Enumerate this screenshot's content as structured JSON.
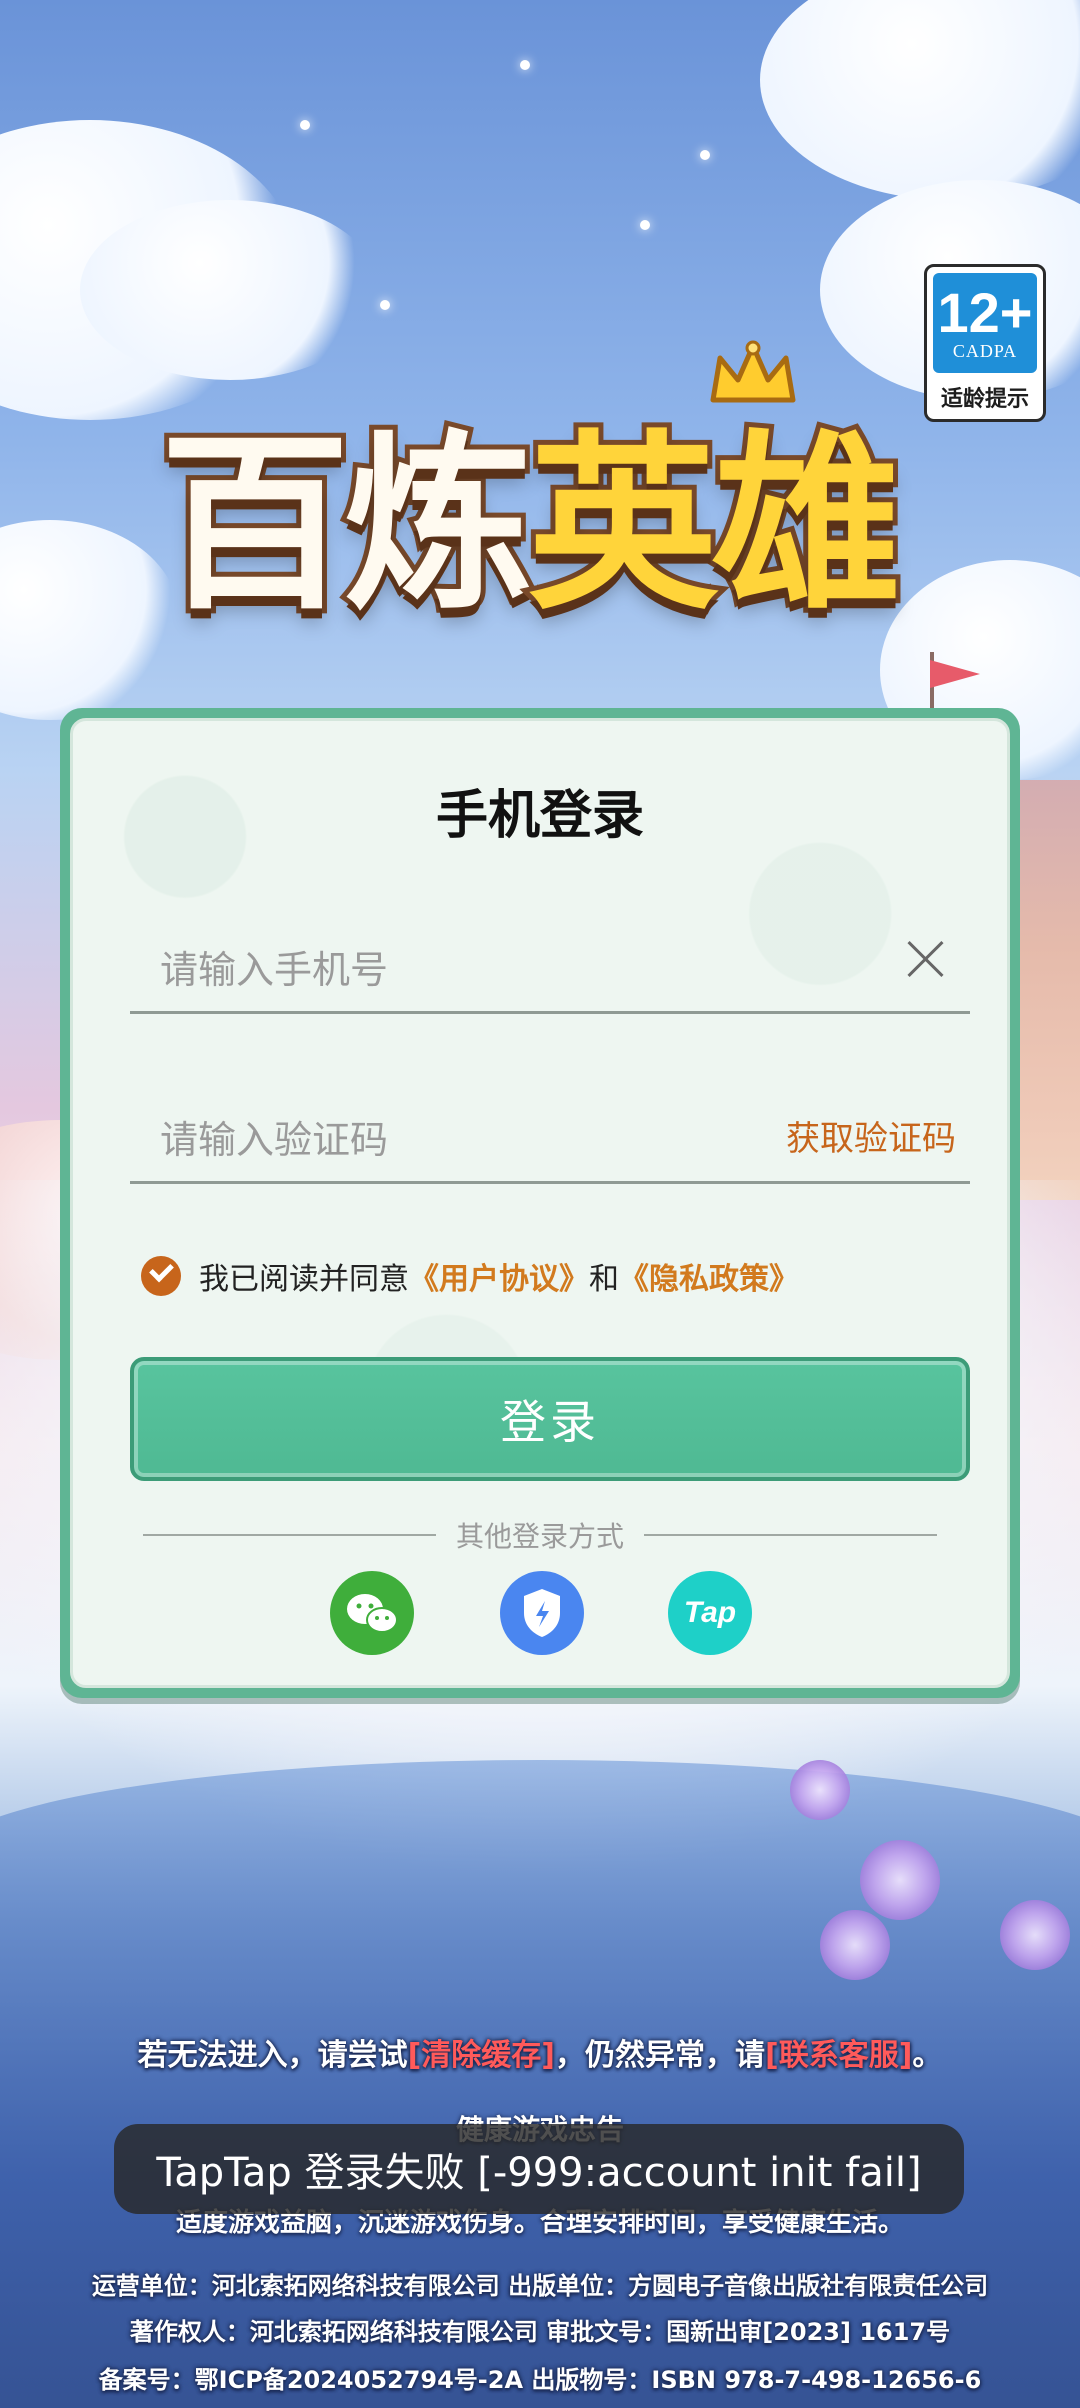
{
  "age_rating": {
    "number": "12+",
    "org": "CADPA",
    "tip": "适龄提示"
  },
  "logo": {
    "part1": "百炼",
    "part2": "英雄"
  },
  "login": {
    "title": "手机登录",
    "phone_placeholder": "请输入手机号",
    "code_placeholder": "请输入验证码",
    "get_code_label": "获取验证码",
    "agree_text": "我已阅读并同意",
    "user_agreement": "《用户协议》",
    "and_text": "和",
    "privacy_policy": "《隐私政策》",
    "login_button": "登录",
    "other_methods": "其他登录方式",
    "social": {
      "tap_label": "Tap"
    }
  },
  "bottom": {
    "tip_prefix": "若无法进入，请尝试",
    "clear_cache": "[清除缓存]",
    "tip_middle": "，仍然异常，请",
    "contact_service": "[联系客服]",
    "tip_suffix": "。",
    "health_title": "健康游戏忠告",
    "health_line": "适度游戏益脑，沉迷游戏伤身。合理安排时间，享受健康生活。",
    "legal_line1": "运营单位：河北索拓网络科技有限公司  出版单位：方圆电子音像出版社有限责任公司",
    "legal_line2": "著作权人：河北索拓网络科技有限公司  审批文号：国新出审[2023] 1617号",
    "legal_line3": "备案号：鄂ICP备2024052794号-2A  出版物号：ISBN 978-7-498-12656-6"
  },
  "toast": {
    "message": "TapTap 登录失败 [-999:account init fail]"
  }
}
